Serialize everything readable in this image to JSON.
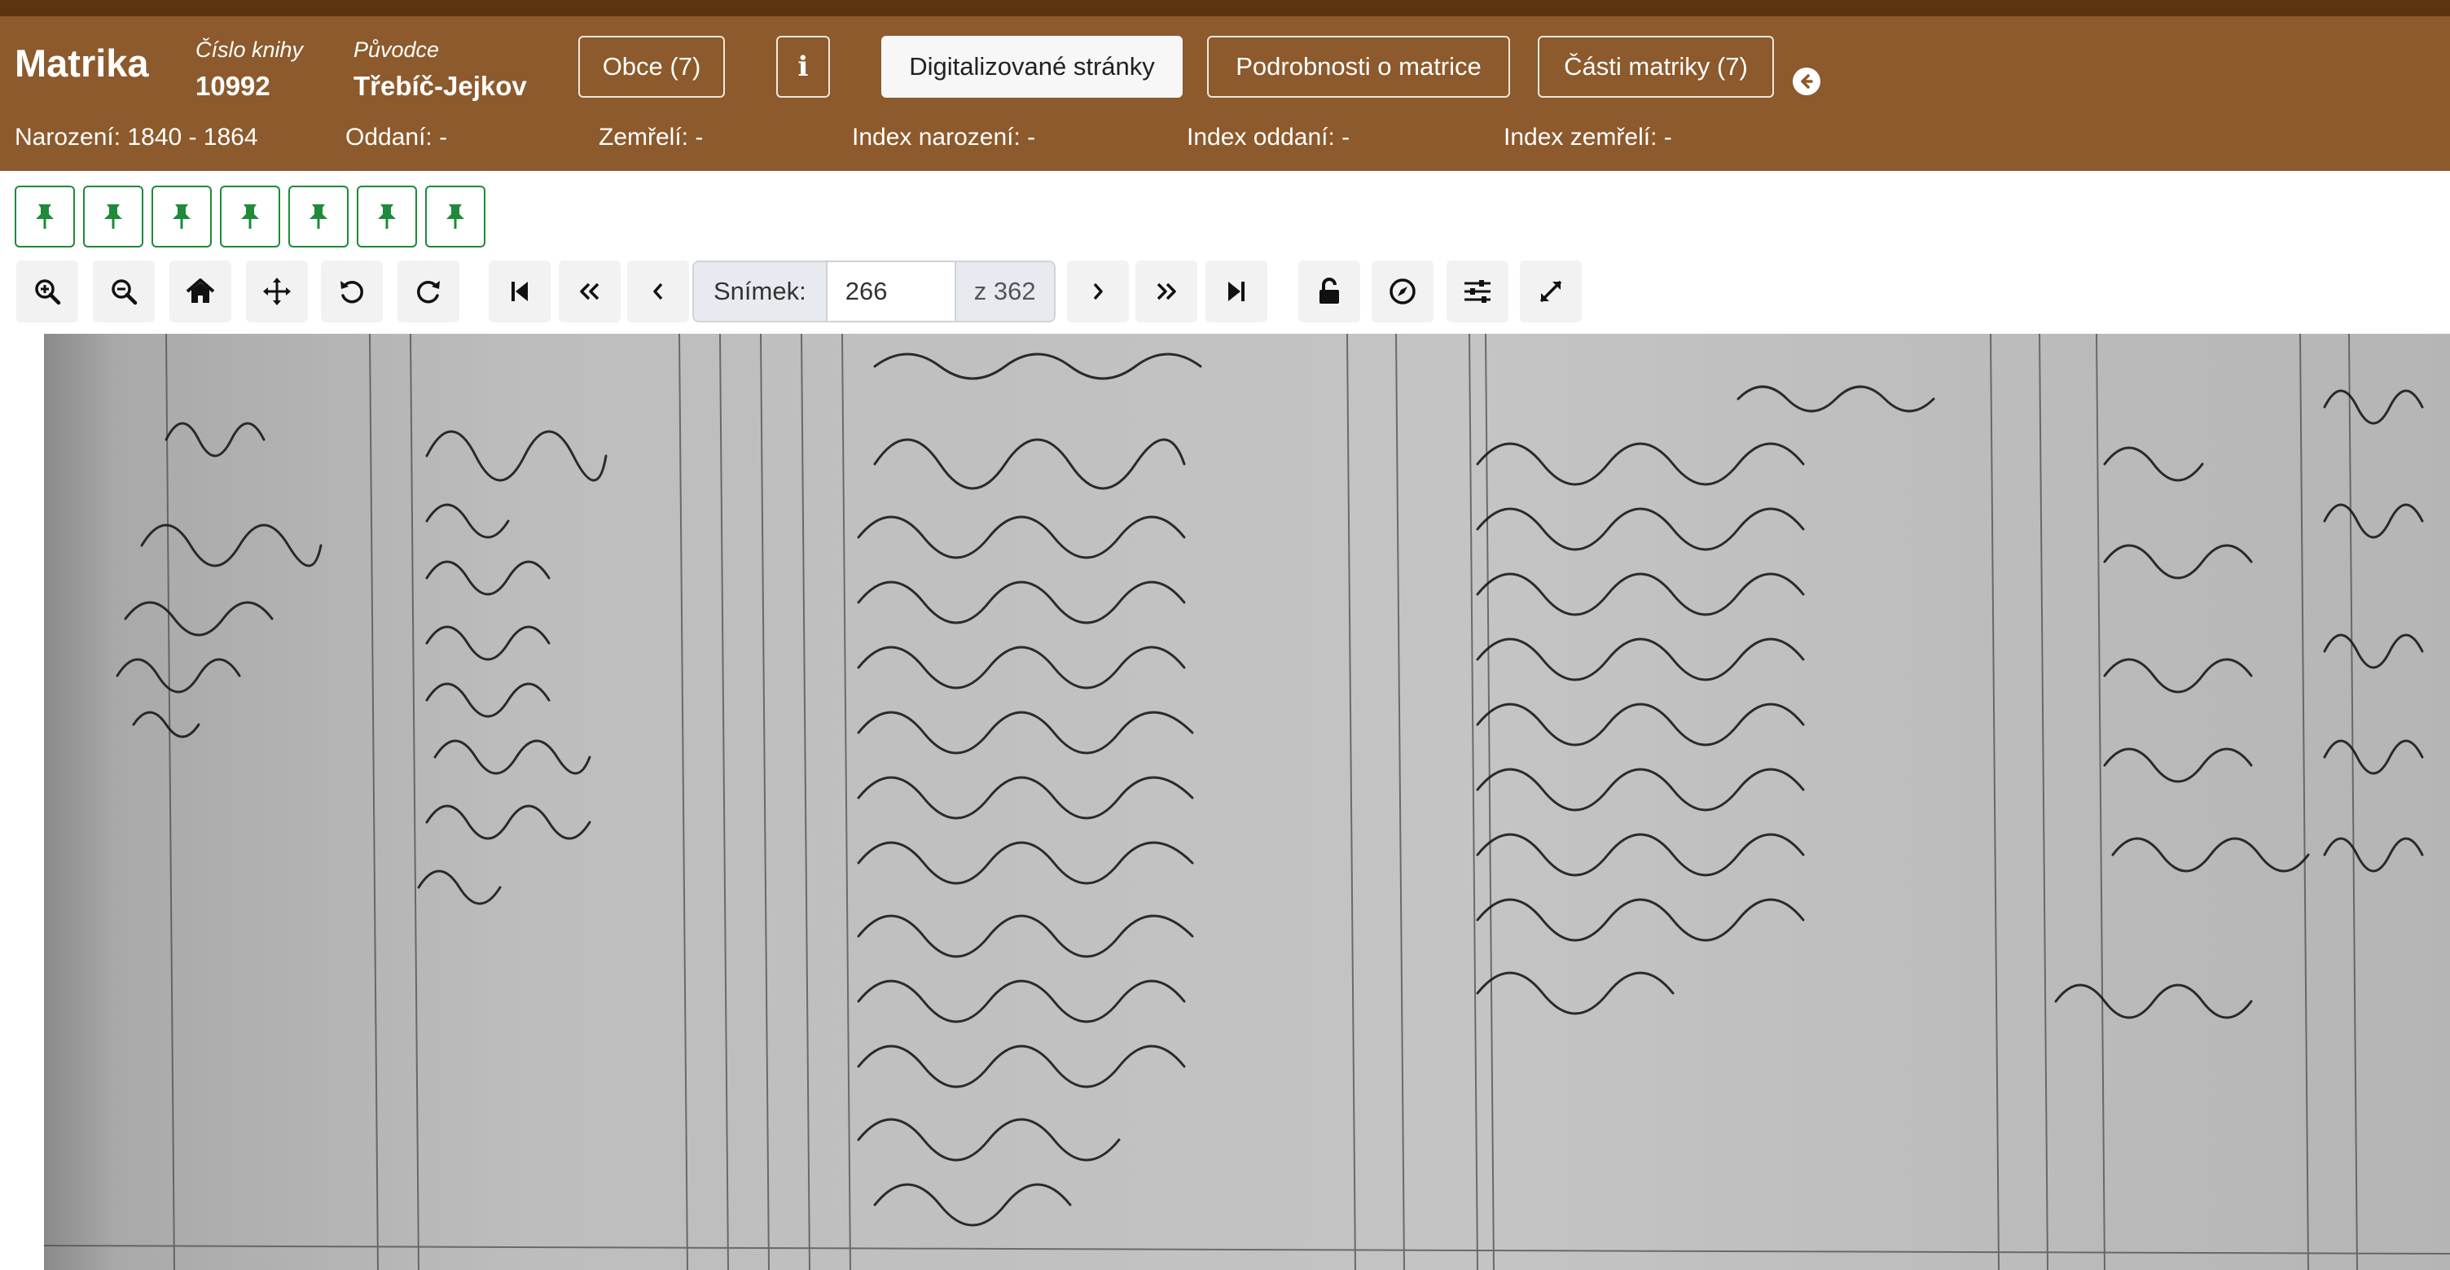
{
  "header": {
    "app_title": "Matrika",
    "book_number_label": "Číslo knihy",
    "book_number": "10992",
    "origin_label": "Původce",
    "origin": "Třebíč-Jejkov",
    "buttons": {
      "municipalities": "Obce (7)",
      "info": "i",
      "digitized_pages": "Digitalizované stránky",
      "details": "Podrobnosti o matrice",
      "parts": "Části matriky (7)"
    },
    "stats": {
      "births": "Narození: 1840 - 1864",
      "marriages": "Oddaní: -",
      "deaths": "Zemřelí: -",
      "birth_index": "Index narození: -",
      "marriage_index": "Index oddaní: -",
      "death_index": "Index zemřelí: -"
    },
    "colors": {
      "bar": "#8c5a2c",
      "top_strip": "#5e3410",
      "pin_green": "#1e8a3a"
    }
  },
  "pins": {
    "count": 7,
    "icon": "pin-icon"
  },
  "toolbar": {
    "icons": [
      "zoom-in-icon",
      "zoom-out-icon",
      "home-icon",
      "move-icon",
      "rotate-left-icon",
      "rotate-right-icon",
      "first-page-icon",
      "fast-back-icon",
      "prev-icon",
      "next-icon",
      "fast-forward-icon",
      "last-page-icon",
      "lock-icon",
      "compass-icon",
      "sliders-icon",
      "fullscreen-icon"
    ],
    "frame_label": "Snímek:",
    "frame_value": "266",
    "frame_total": "z 362"
  },
  "viewer": {
    "content": "scanned-register-page"
  }
}
